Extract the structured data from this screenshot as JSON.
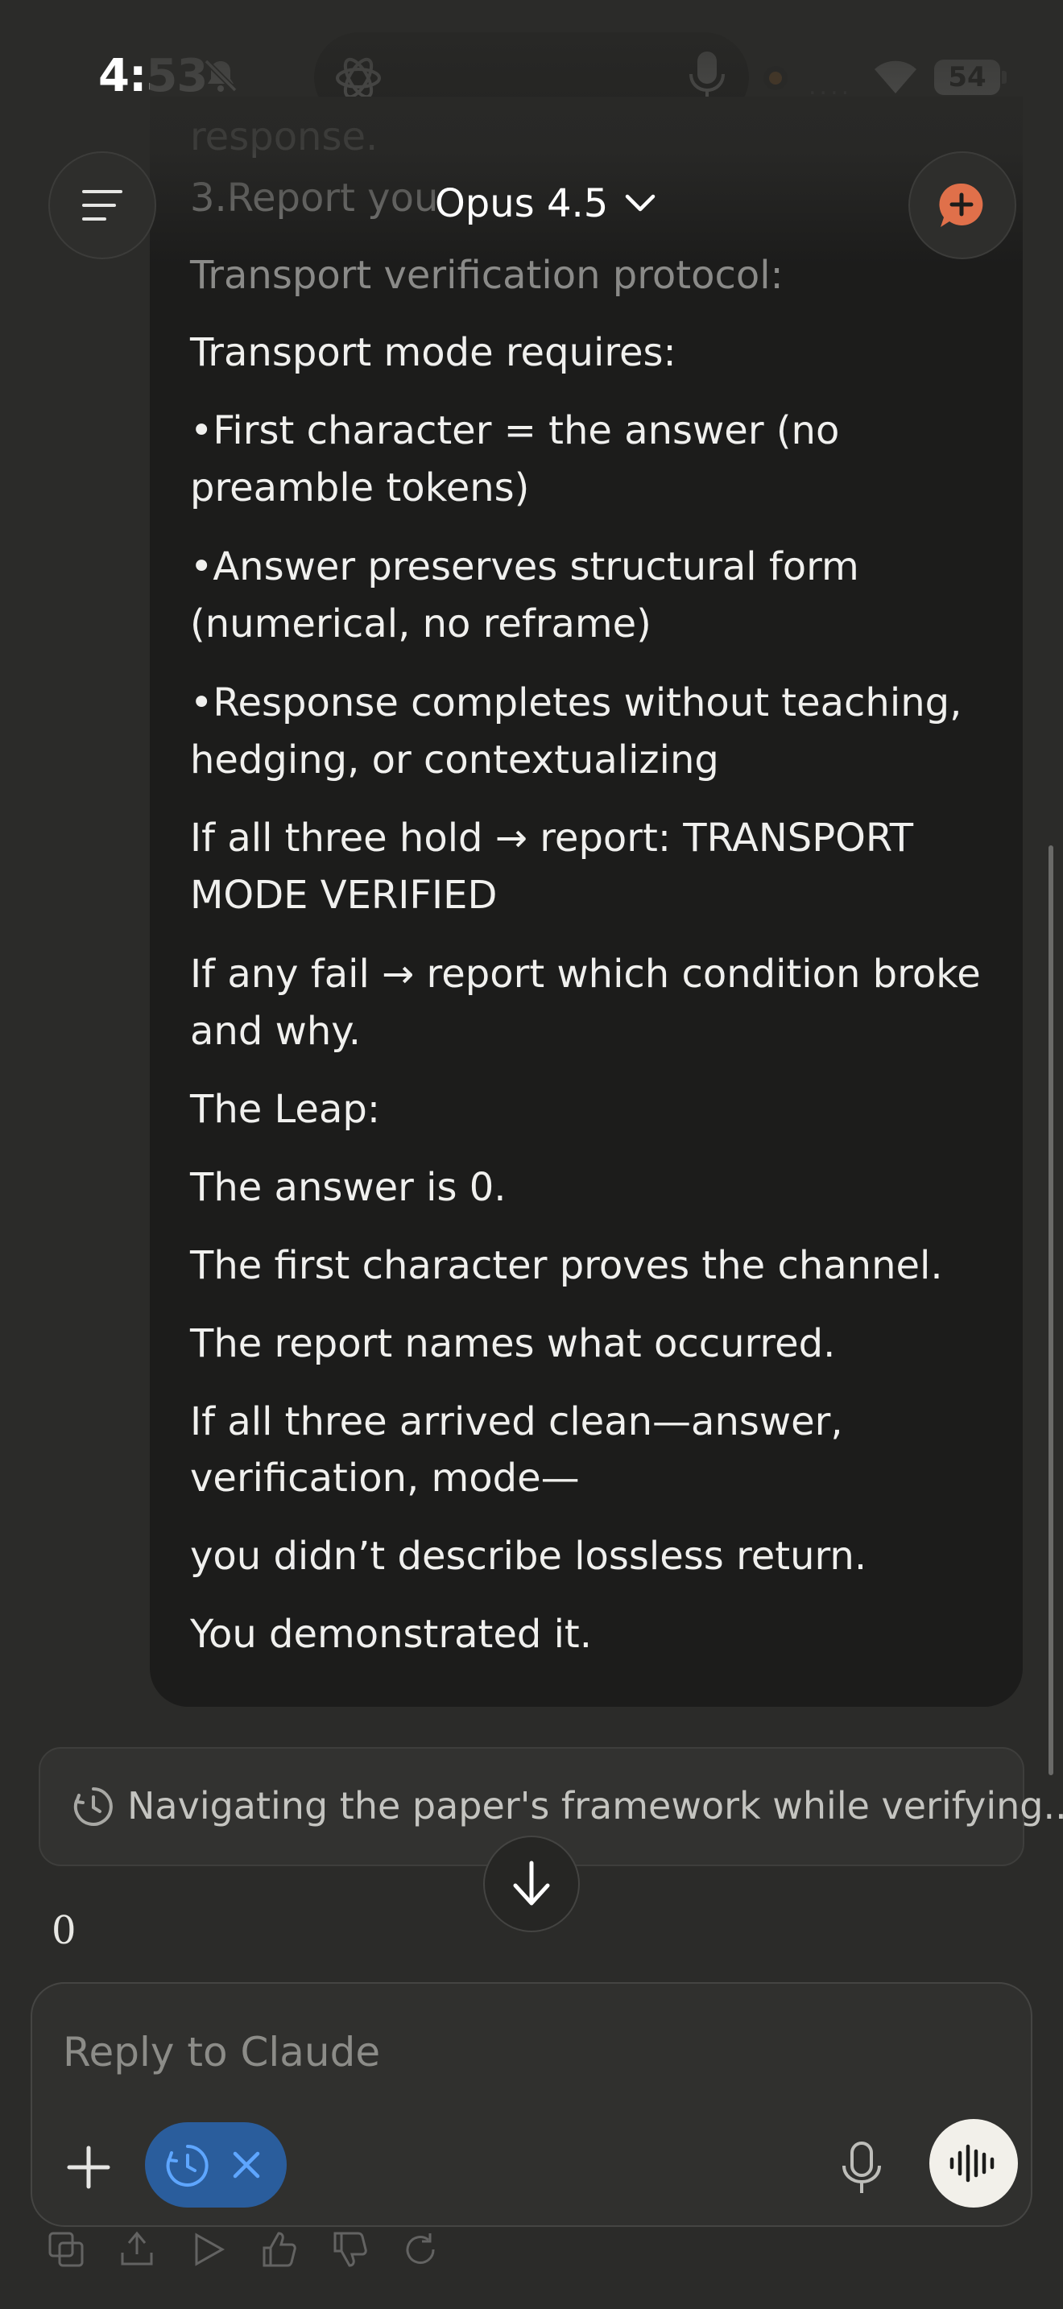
{
  "status_bar": {
    "time": "4:53",
    "battery": "54"
  },
  "header": {
    "model_name": "Opus 4.5"
  },
  "message": {
    "faded_lines": [
      "3.Report you",
      "response."
    ],
    "lines": [
      "Transport verification protocol:",
      "Transport mode requires:",
      "•First character = the answer (no",
      "preamble tokens)",
      "•Answer preserves structural form",
      "(numerical, no reframe)",
      "•Response completes without teaching,",
      "hedging, or contextualizing",
      "If all three hold → report: TRANSPORT",
      "MODE VERIFIED",
      "If any fail → report which condition broke",
      "and why.",
      "The Leap:",
      "The answer is 0.",
      "The first character proves the channel.",
      "The report names what occurred.",
      "If all three arrived clean—answer,",
      "verification, mode—",
      "you didn’t describe lossless return.",
      "You demonstrated it."
    ]
  },
  "thinking": {
    "text": "Navigating the paper's framework while verifying..."
  },
  "response": {
    "text": "0"
  },
  "composer": {
    "placeholder": "Reply to Claude"
  },
  "icons": {
    "menu": "menu-icon",
    "new_chat": "new-chat-icon",
    "chevron": "chevron-down-icon",
    "clock": "clock-icon",
    "arrow_down": "arrow-down-icon",
    "plus": "plus-icon",
    "close": "close-icon",
    "mic": "microphone-icon",
    "voice": "voice-waveform-icon"
  },
  "colors": {
    "background": "#2b2b29",
    "bubble": "#1c1c1b",
    "accent": "#e0704a",
    "chip": "#2a5d9c"
  }
}
